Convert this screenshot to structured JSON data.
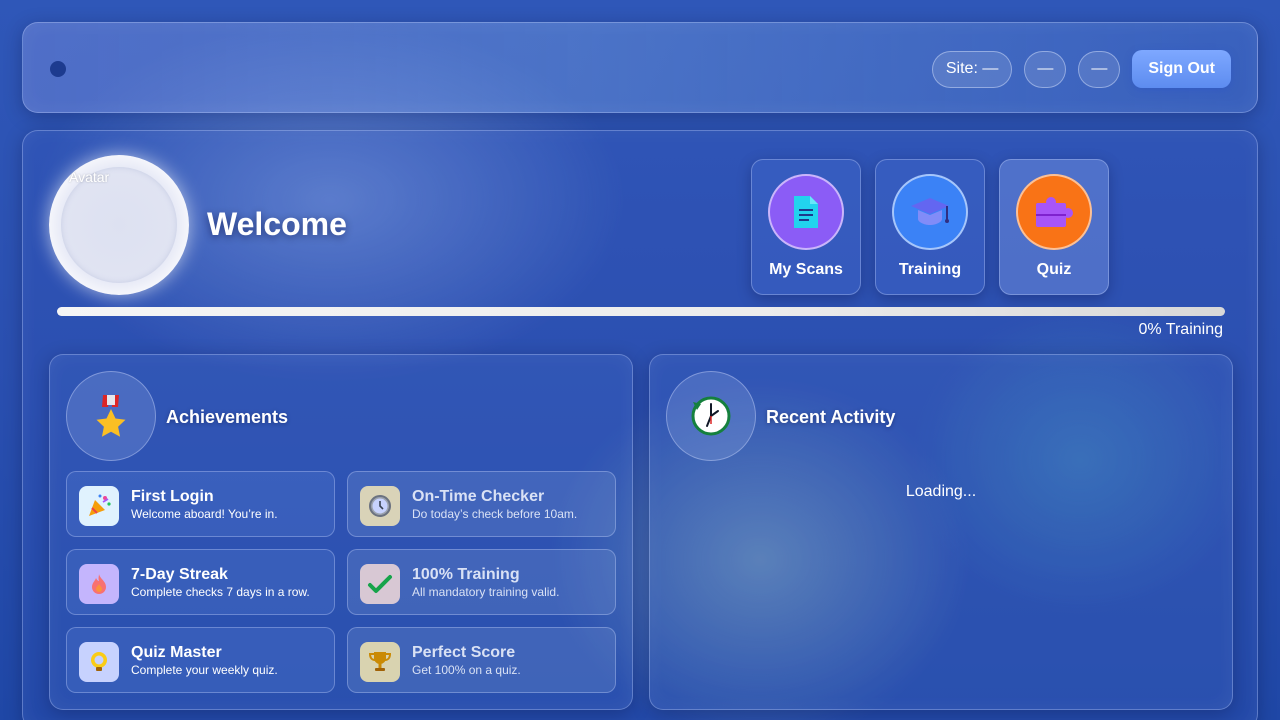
{
  "header": {
    "site_label": "Site: —",
    "btn2_label": "—",
    "btn3_label": "—",
    "signout_label": "Sign Out"
  },
  "profile": {
    "avatar_alt": "Avatar",
    "welcome": "Welcome"
  },
  "tiles": [
    {
      "label": "My Scans",
      "icon": "document-icon",
      "color": "#8b5cf6"
    },
    {
      "label": "Training",
      "icon": "graduation-cap-icon",
      "color": "#3b82f6"
    },
    {
      "label": "Quiz",
      "icon": "puzzle-icon",
      "color": "#f97316"
    }
  ],
  "progress": {
    "value": 0,
    "label": "0% Training"
  },
  "achievements": {
    "title": "Achievements",
    "items": [
      {
        "title": "First Login",
        "desc": "Welcome aboard! You’re in.",
        "icon": "party-popper-icon",
        "locked": false
      },
      {
        "title": "On-Time Checker",
        "desc": "Do today’s check before 10am.",
        "icon": "clock-icon",
        "locked": true
      },
      {
        "title": "7-Day Streak",
        "desc": "Complete checks 7 days in a row.",
        "icon": "flame-icon",
        "locked": false
      },
      {
        "title": "100% Training",
        "desc": "All mandatory training valid.",
        "icon": "checkmark-icon",
        "locked": true
      },
      {
        "title": "Quiz Master",
        "desc": "Complete your weekly quiz.",
        "icon": "lightbulb-icon",
        "locked": false
      },
      {
        "title": "Perfect Score",
        "desc": "Get 100% on a quiz.",
        "icon": "trophy-icon",
        "locked": true
      }
    ]
  },
  "activity": {
    "title": "Recent Activity",
    "status": "Loading..."
  }
}
